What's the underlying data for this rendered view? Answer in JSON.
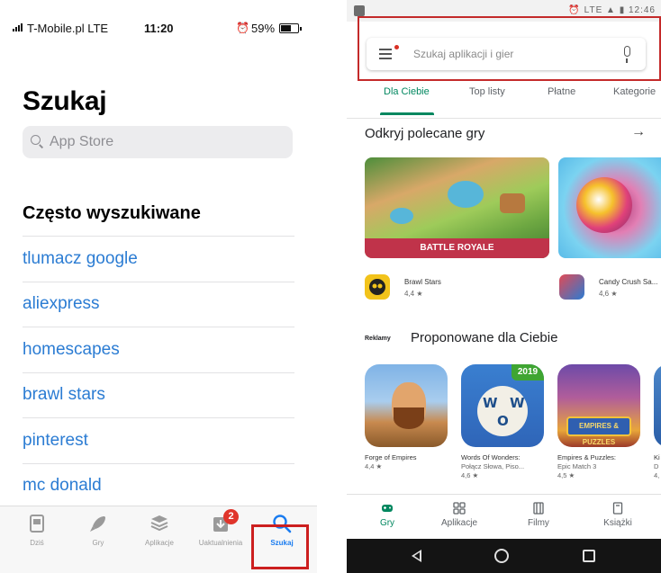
{
  "ios": {
    "status": {
      "carrier": "T-Mobile.pl  LTE",
      "time": "11:20",
      "battery_pct": "59%"
    },
    "title": "Szukaj",
    "search_placeholder": "App Store",
    "section_title": "Często wyszukiwane",
    "trending": [
      "tlumacz google",
      "aliexpress",
      "homescapes",
      "brawl stars",
      "pinterest",
      "mc donald"
    ],
    "tabs": [
      {
        "label": "Dziś",
        "icon": "today-icon"
      },
      {
        "label": "Gry",
        "icon": "rocket-icon"
      },
      {
        "label": "Aplikacje",
        "icon": "apps-stack-icon"
      },
      {
        "label": "Uaktualnienia",
        "icon": "updates-icon",
        "badge": "2"
      },
      {
        "label": "Szukaj",
        "icon": "search-icon",
        "active": true
      }
    ],
    "accent_color": "#1a7cf0",
    "link_color": "#2b7cd3"
  },
  "play": {
    "status_right": "⏰ LTE ▲ ▮ 12:46",
    "search_placeholder": "Szukaj aplikacji i gier",
    "tabs": [
      "Dla Ciebie",
      "Top listy",
      "Płatne",
      "Kategorie"
    ],
    "active_tab": "Dla Ciebie",
    "featured_title": "Odkryj polecane gry",
    "featured_arrow": "→",
    "banner_caption": "BATTLE ROYALE",
    "games": [
      {
        "name": "Brawl Stars",
        "rating": "4,4 ★"
      },
      {
        "name": "Candy Crush Sa...",
        "rating": "4,6 ★"
      }
    ],
    "ads_label": "Reklamy",
    "suggested_title": "Proponowane dla Ciebie",
    "badge_2019": "2019",
    "empires_plate": "EMPIRES & PUZZLES",
    "wow_letters": [
      "W",
      "O",
      "W"
    ],
    "apps": [
      {
        "line1": "Forge of Empires",
        "line2": "4,4 ★",
        "line3": ""
      },
      {
        "line1": "Words Of Wonders:",
        "line2": "Połącz Słowa, Piso...",
        "line3": "4,6 ★"
      },
      {
        "line1": "Empires & Puzzles:",
        "line2": "Epic Match 3",
        "line3": "4,5 ★"
      },
      {
        "line1": "Ki",
        "line2": "D",
        "line3": "4,"
      }
    ],
    "bottom_nav": [
      {
        "label": "Gry",
        "icon": "gamepad-icon",
        "active": true
      },
      {
        "label": "Aplikacje",
        "icon": "apps-grid-icon"
      },
      {
        "label": "Filmy",
        "icon": "film-icon"
      },
      {
        "label": "Książki",
        "icon": "book-icon"
      }
    ],
    "accent_color": "#01875f"
  },
  "highlight_color": "#cc1f1f"
}
